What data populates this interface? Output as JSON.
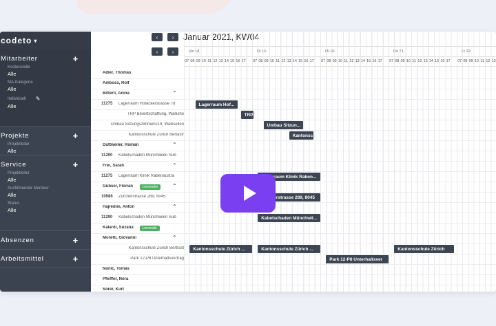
{
  "brand": {
    "name": "codeto",
    "caret": "▾"
  },
  "sidebar": {
    "sections": [
      {
        "title": "Mitarbeiter",
        "filters": [
          {
            "label": "Kostenstelle",
            "value": "Alle"
          },
          {
            "label": "MA-Kategorie",
            "value": "Alle"
          },
          {
            "label": "Individuell",
            "value": "Alle"
          }
        ]
      },
      {
        "title": "Projekte",
        "filters": [
          {
            "label": "Projektleiter",
            "value": "Alle"
          }
        ]
      },
      {
        "title": "Service",
        "filters": [
          {
            "label": "Projektleiter",
            "value": "Alle"
          },
          {
            "label": "Ausführender Monteur",
            "value": "Alle"
          },
          {
            "label": "Status",
            "value": "Alle"
          }
        ]
      },
      {
        "title": "Absenzen",
        "filters": []
      },
      {
        "title": "Arbeitsmittel",
        "filters": []
      }
    ]
  },
  "header": {
    "title": "Januar 2021, KW04",
    "prev": "‹",
    "next": "›",
    "days": [
      "Mo 18.",
      "Di 19.",
      "Mi 20.",
      "Do 21.",
      "Fr 22."
    ],
    "hours": [
      "07",
      "08",
      "09",
      "10",
      "11",
      "12",
      "13",
      "14",
      "15",
      "16",
      "17"
    ]
  },
  "rows": [
    {
      "type": "person",
      "name": "Adler, Thomas"
    },
    {
      "type": "person",
      "name": "Amboss, Rolf"
    },
    {
      "type": "person",
      "name": "Bitterli, Anina",
      "expanded": true
    },
    {
      "type": "project",
      "num": "11275",
      "text": "Lagerraum Hofackerstrasse 78"
    },
    {
      "type": "project",
      "num": "",
      "text": "TRP Bewirtschaftung, Wallisho"
    },
    {
      "type": "project",
      "num": "",
      "text": "Umbau SitzungszimmerU19, Wallisellen"
    },
    {
      "type": "project",
      "num": "",
      "text": "Kantonsschule Zürich Bertastr"
    },
    {
      "type": "person",
      "name": "Duttweiler, Roman",
      "expanded": true
    },
    {
      "type": "project",
      "num": "11290",
      "text": "Kabelschaden Münchwilen Sub"
    },
    {
      "type": "person",
      "name": "Frei, Sarah",
      "expanded": true
    },
    {
      "type": "project",
      "num": "11275",
      "text": "Lagerraum Klinik Rabenaustra"
    },
    {
      "type": "person",
      "name": "Gubser, Florian",
      "badge": "Lernender",
      "expanded": true
    },
    {
      "type": "project",
      "num": "10986",
      "text": "Zürcherstrasse 289, 8045"
    },
    {
      "type": "person",
      "name": "Hajredini, Anton",
      "expanded": true
    },
    {
      "type": "project",
      "num": "11290",
      "text": "Kabelschaden Münchwilen Sub"
    },
    {
      "type": "person",
      "name": "Kalardi, Suzana",
      "badge": "Lernende"
    },
    {
      "type": "person",
      "name": "Moretti, Giovanni",
      "expanded": true
    },
    {
      "type": "project",
      "num": "",
      "text": "Kantonsschule Zürich Bertrast"
    },
    {
      "type": "project",
      "num": "",
      "text": "Park 12-P8 Unterhaltsvertrag"
    },
    {
      "type": "person",
      "name": "Nunic, Tomas"
    },
    {
      "type": "person",
      "name": "Pfeiffer, Nora"
    },
    {
      "type": "person",
      "name": "Sorer, Kurt"
    }
  ],
  "bars": [
    {
      "row": 3,
      "text": "Lagerraum Hof...",
      "start": 2,
      "len": 7.5
    },
    {
      "row": 4,
      "text": "TRP",
      "start": 10,
      "len": 2.3
    },
    {
      "row": 5,
      "text": "Umbau Sitzun...",
      "start": 14,
      "len": 7
    },
    {
      "row": 6,
      "text": "Kantonsc",
      "start": 18.5,
      "len": 4.3
    },
    {
      "row": 10,
      "text": "Lagerraum Klinik Raben...",
      "start": 13,
      "len": 11
    },
    {
      "row": 12,
      "text": "Zürcherstrasse 289, 8045",
      "start": 13,
      "len": 11
    },
    {
      "row": 14,
      "text": "Kabelschaden Münchwil...",
      "start": 13,
      "len": 11
    },
    {
      "row": 17,
      "text": "Kantonsschule Zürich ...",
      "start": 1,
      "len": 11
    },
    {
      "row": 17,
      "text": "Kantonsschule Zürich ...",
      "start": 13,
      "len": 11
    },
    {
      "row": 17,
      "text": "Kantonsschule Zürich",
      "start": 37,
      "len": 10.5
    },
    {
      "row": 18,
      "text": "Park 12-P8 Unterhaltsver",
      "start": 25,
      "len": 11
    }
  ]
}
